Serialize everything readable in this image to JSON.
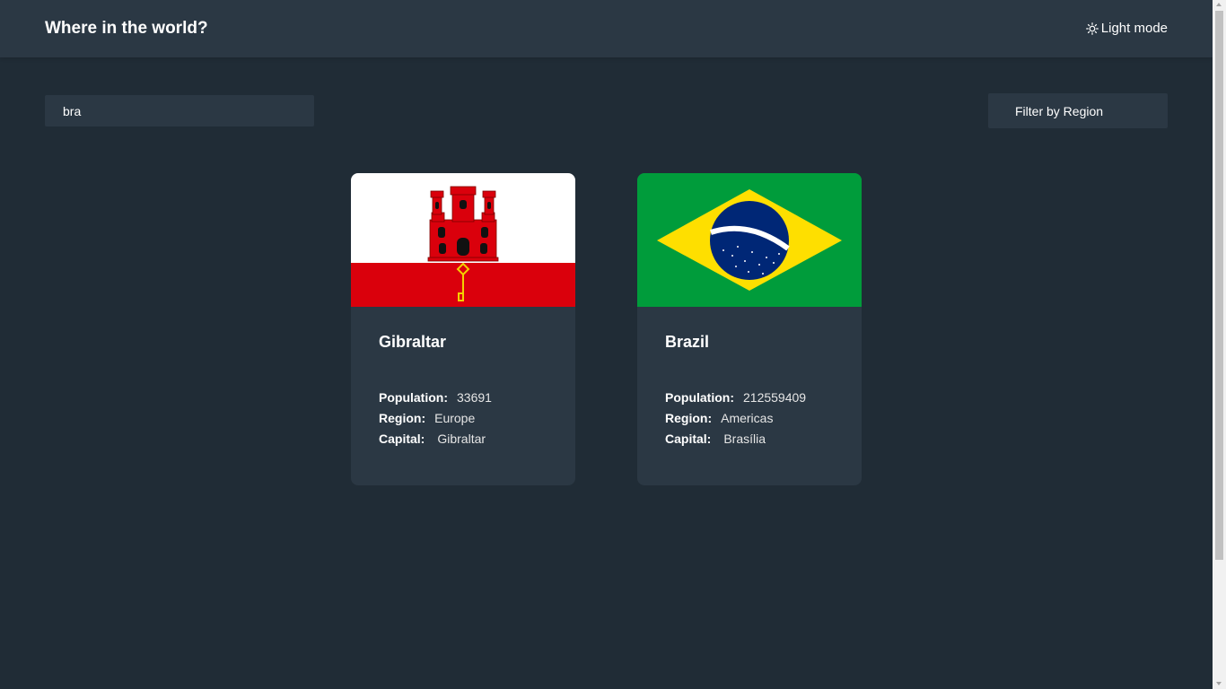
{
  "header": {
    "title": "Where in the world?",
    "theme_toggle_label": "Light mode",
    "theme_icon": "sun-icon"
  },
  "search": {
    "value": "bra",
    "icon": "search-icon"
  },
  "filter": {
    "label": "Filter by Region"
  },
  "cards": [
    {
      "name": "Gibraltar",
      "population_label": "Population:",
      "population": "33691",
      "region_label": "Region:",
      "region": "Europe",
      "capital_label": "Capital:",
      "capital": "Gibraltar",
      "flag": "gibraltar-flag"
    },
    {
      "name": "Brazil",
      "population_label": "Population:",
      "population": "212559409",
      "region_label": "Region:",
      "region": "Americas",
      "capital_label": "Capital:",
      "capital": "Brasília",
      "flag": "brazil-flag"
    }
  ],
  "colors": {
    "background": "#202c36",
    "surface": "#2b3844",
    "text": "#ffffff"
  }
}
